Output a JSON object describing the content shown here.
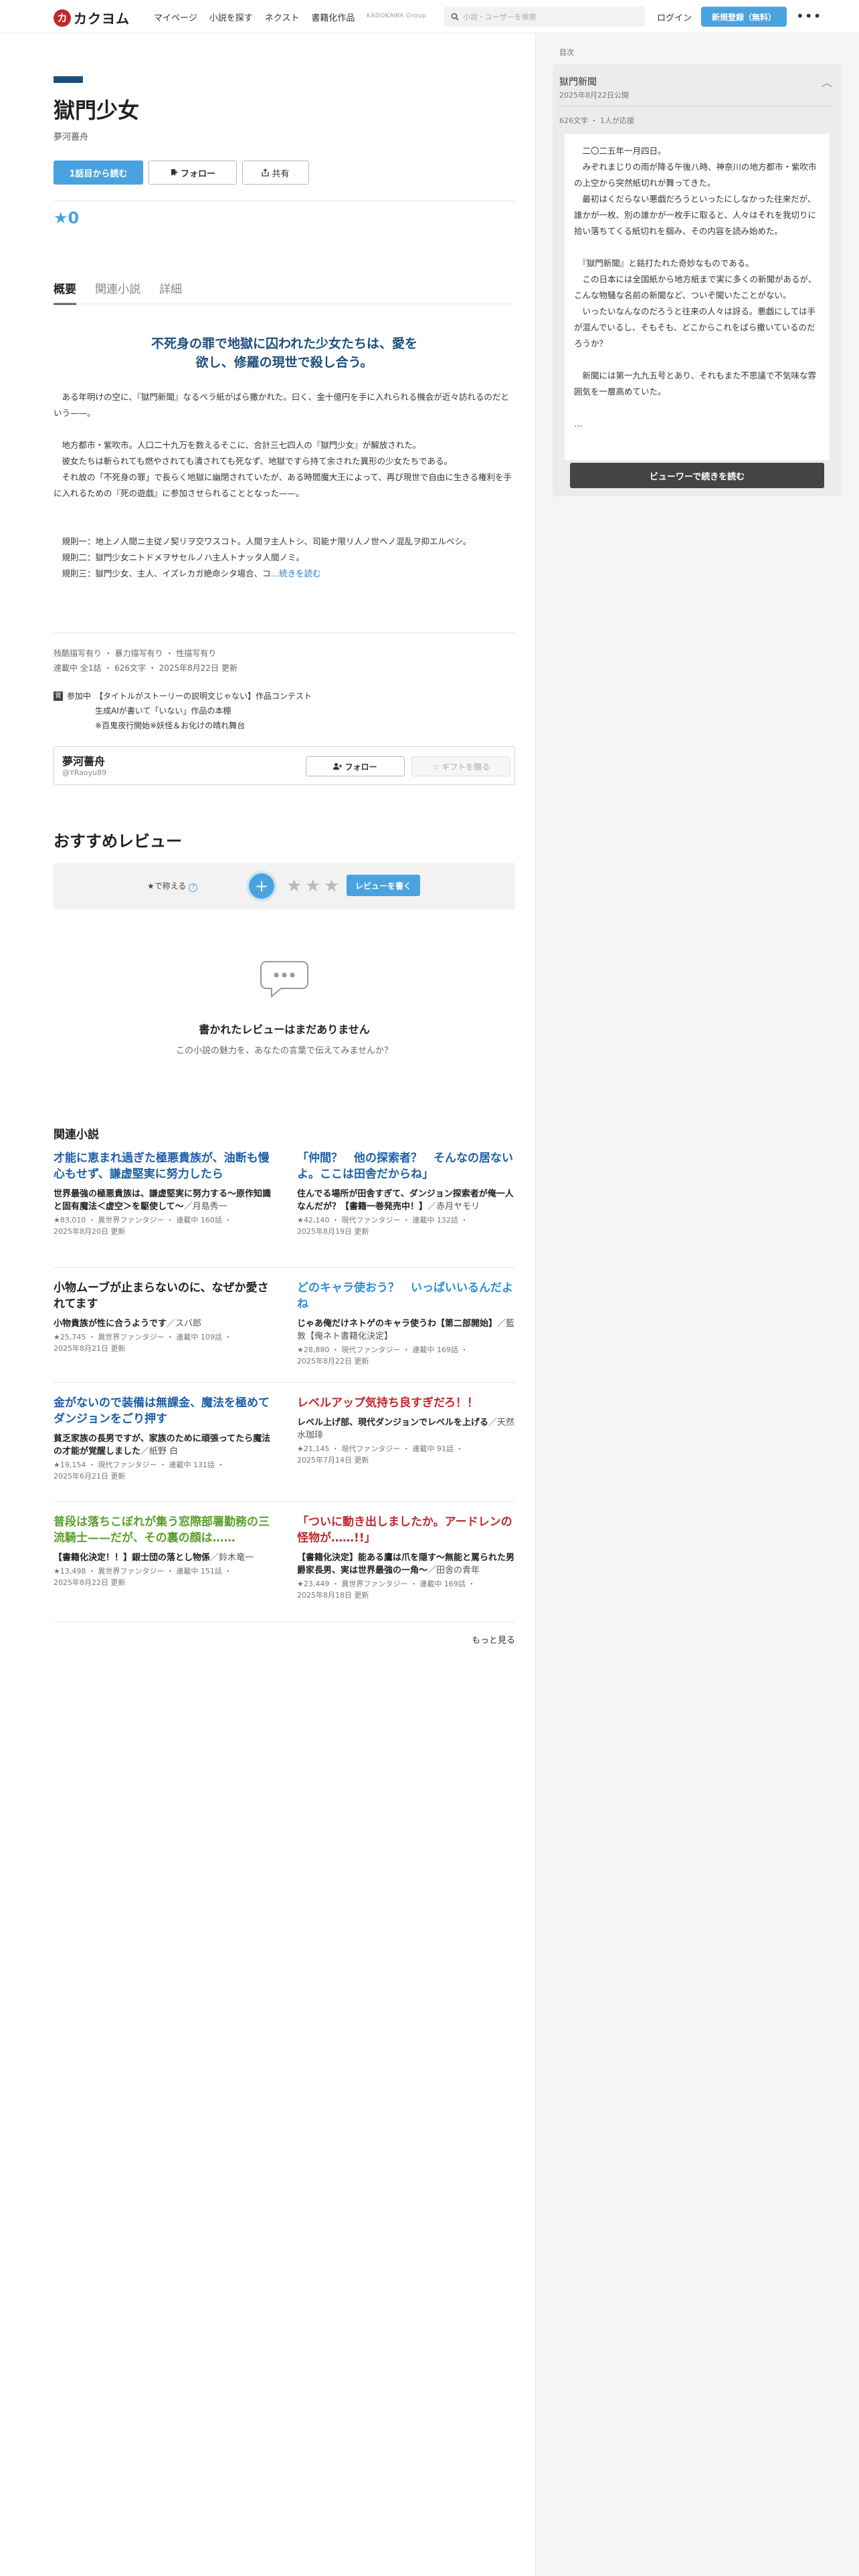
{
  "header": {
    "logo_mark": "カ",
    "logo_text": "カクヨム",
    "nav": [
      "マイページ",
      "小説を探す",
      "ネクスト",
      "書籍化作品"
    ],
    "group_label": "KADOKAWA Group",
    "search_placeholder": "小説・ユーザーを検索",
    "login": "ログイン",
    "signup": "新規登録（無料）",
    "more": "•••"
  },
  "work": {
    "title": "獄門少女",
    "author": "夢河薔舟",
    "read_first": "1話目から読む",
    "follow": "フォロー",
    "share": "共有",
    "stars": "★0"
  },
  "tabs": [
    "概要",
    "関連小説",
    "詳細"
  ],
  "intro": {
    "catch_lines": [
      "不死身の罪で地獄に囚われた少女たちは、愛を",
      "欲し、修羅の現世で殺し合う。"
    ],
    "paragraphs": [
      "　ある年明けの空に、『獄門新聞』なるペラ紙がばら撒かれた。曰く、金十億円を手に入れられる機会が近々訪れるのだという——。",
      "",
      "　地方都市・紫吹市。人口二十九万を数えるそこに、合計三七四人の『獄門少女』が解放された。",
      "　彼女たちは斬られても燃やされても潰されても死なず、地獄ですら持て余された異形の少女たちである。",
      "　それ故の「不死身の罪」で長らく地獄に幽閉されていたが、ある時閻魔大王によって、再び現世で自由に生きる権利を手に入れるための『死の遊戯』に参加させられることとなった——。",
      "",
      "",
      "　規則一：地上ノ人間ニ主従ノ契リヲ交ワスコト。人間ヲ主人トシ、司能ナ限リ人ノ世ヘノ混乱ヲ抑エルベシ。",
      "　規則二：獄門少女ニトドメヲサセルノハ主人トナッタ人間ノミ。"
    ],
    "last_line": "　規則三：獄門少女、主人、イズレカガ絶命シタ場合、コ",
    "read_more": "…続きを読む"
  },
  "tags": {
    "warnings": "残酷描写有り ・ 暴力描写有り ・ 性描写有り",
    "status": "連載中 全1話 ・ 626文字 ・ 2025年8月22日 更新"
  },
  "contest": {
    "badge": "賞",
    "label": "参加中",
    "lines": [
      "【タイトルがストーリーの説明文じゃない】作品コンテスト",
      "生成AIが書いて「いない」作品の本棚",
      "※百鬼夜行開始※妖怪＆お化けの晴れ舞台"
    ]
  },
  "author_box": {
    "name": "夢河薔舟",
    "id": "@YRaoyu89",
    "follow": "フォロー",
    "gift": "☆ ギフトを贈る"
  },
  "reviews": {
    "title": "おすすめレビュー",
    "rate_label": "★で称える",
    "help": "?",
    "plus": "+",
    "star": "★",
    "write": "レビューを書く",
    "empty_title": "書かれたレビューはまだありません",
    "empty_sub": "この小説の魅力を、あなたの言葉で伝えてみませんか？"
  },
  "related": {
    "title": "関連小説",
    "more": "もっと見る",
    "items": [
      {
        "work": "才能に恵まれ過ぎた極悪貴族が、油断も慢心もせず、謙虚堅実に努力したら",
        "color": "#1c5fa8",
        "catch": "世界最強の極悪貴族は、謙虚堅実に努力する〜原作知識と固有魔法＜虚空＞を駆使して〜",
        "author": "／月島秀一",
        "meta": [
          "★83,010 ・ 異世界ファンタジー ・ 連載中 160話 ・",
          "2025年8月20日 更新"
        ]
      },
      {
        "work": "「仲間？　他の探索者？　そんなの居ないよ。ここは田舎だからね」",
        "color": "#1c5fa8",
        "catch": "住んでる場所が田舎すぎて、ダンジョン探索者が俺一人なんだが？【書籍一巻発売中！】",
        "author": "／赤月ヤモリ",
        "meta": [
          "★42,140 ・ 現代ファンタジー ・ 連載中 132話 ・",
          "2025年8月19日 更新"
        ]
      },
      {
        "work": "小物ムーブが止まらないのに、なぜか愛されてます",
        "color": "#222222",
        "catch": "小物貴族が性に合うようです",
        "author": "／スバ郎",
        "meta": [
          "★25,745 ・ 異世界ファンタジー ・ 連載中 109話 ・",
          "2025年8月21日 更新"
        ]
      },
      {
        "work": "どのキャラ使おう？　いっぱいいるんだよね",
        "color": "#2a8fd8",
        "catch": "じゃあ俺だけネトゲのキャラ使うわ【第二部開始】",
        "author": "／藍敦【俺ネト書籍化決定】",
        "meta": [
          "★28,880 ・ 現代ファンタジー ・ 連載中 169話 ・",
          "2025年8月22日 更新"
        ]
      },
      {
        "work": "金がないので装備は無課金、魔法を極めてダンジョンをごり押す",
        "color": "#1c5fa8",
        "catch": "貧乏家族の長男ですが、家族のために頑張ってたら魔法の才能が覚醒しました",
        "author": "／紙野 白",
        "meta": [
          "★19,154 ・ 現代ファンタジー ・ 連載中 131話 ・",
          "2025年6月21日 更新"
        ]
      },
      {
        "work": "レベルアップ気持ち良すぎだろ！！",
        "color": "#c0282e",
        "catch": "レベル上げ部、現代ダンジョンでレベルを上げる",
        "author": "／天然水珈琲",
        "meta": [
          "★21,145 ・ 現代ファンタジー ・ 連載中 91話 ・",
          "2025年7月14日 更新"
        ]
      },
      {
        "work": "普段は落ちこぼれが集う窓際部署勤務の三流騎士——だが、その裏の顔は……",
        "color": "#5aa02c",
        "catch": "【書籍化決定！！】銀士団の落とし物係",
        "author": "／鈴木竜一",
        "meta": [
          "★13,498 ・ 異世界ファンタジー ・ 連載中 151話 ・",
          "2025年8月22日 更新"
        ]
      },
      {
        "work": "「ついに動き出しましたか。アードレンの怪物が……!!」",
        "color": "#c0282e",
        "catch": "【書籍化決定】能ある鷹は爪を隠す〜無能と罵られた男爵家長男、実は世界最強の一角〜",
        "author": "／田舎の青年",
        "meta": [
          "★23,449 ・ 異世界ファンタジー ・ 連載中 169話 ・",
          "2025年8月18日 更新"
        ]
      }
    ]
  },
  "sidebar": {
    "label": "目次",
    "episode_title": "獄門新聞",
    "episode_date": "2025年8月22日公開",
    "chevron": "︿",
    "meta": "626文字 ・ 1人が応援",
    "paragraphs": [
      "　二〇二五年一月四日。",
      "　みぞれまじりの雨が降る午後八時、神奈川の地方都市・紫吹市の上空から突然紙切れが舞ってきた。",
      "　最初はくだらない悪戯だろうといったにしなかった往来だが、誰かが一枚、別の誰かが一枚手に取ると、人々はそれを我切りに拾い落ちてくる紙切れを掴み、その内容を読み始めた。",
      "",
      "　『獄門新聞』と銘打たれた奇妙なものである。",
      "　この日本には全国紙から地方紙まで実に多くの新聞があるが、こんな物騒な名前の新聞など、ついぞ聞いたことがない。",
      "　いったいなんなのだろうと往来の人々は訝る。悪戯にしては手が混んでいるし、そもそも、どこからこれをばら撒いているのだろうか？",
      "",
      "　新聞には第一九九五号とあり、それもまた不思議で不気味な雰囲気を一層高めていた。",
      "",
      "…"
    ],
    "button": "ビューワーで続きを読む"
  }
}
